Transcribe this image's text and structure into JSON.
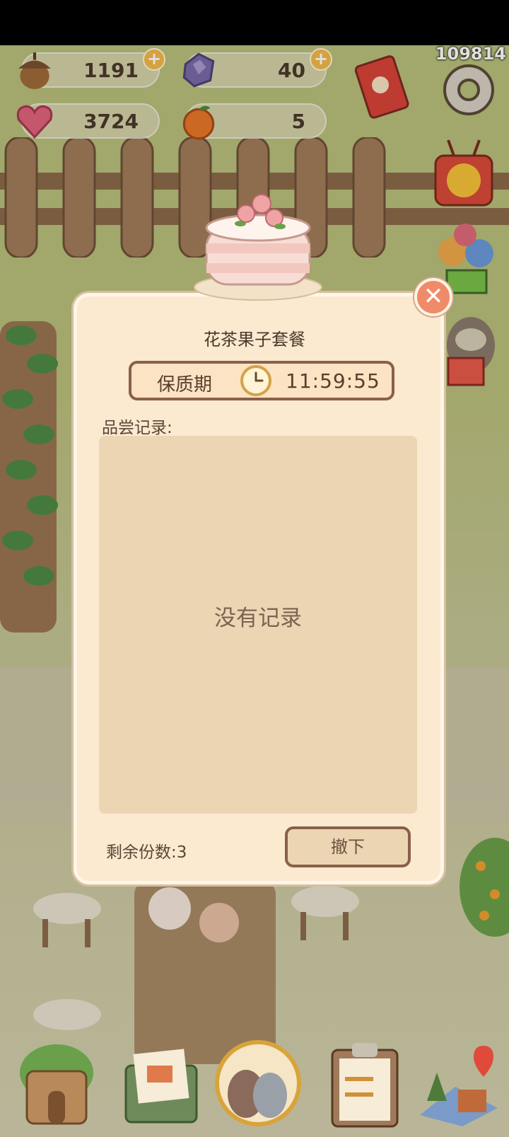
{
  "top_counter": "109814",
  "resources": {
    "acorn": {
      "value": "1191",
      "icon": "acorn-icon"
    },
    "gem": {
      "value": "40",
      "icon": "purple-gem-icon"
    },
    "heart": {
      "value": "3724",
      "icon": "pink-heart-icon"
    },
    "orange": {
      "value": "5",
      "icon": "orange-fruit-icon"
    },
    "plus": "+"
  },
  "dialog": {
    "title": "花茶果子套餐",
    "shelf_life_label": "保质期",
    "shelf_life_time": "11:59:55",
    "records_label": "品尝记录:",
    "empty_text": "没有记录",
    "remaining_label": "剩余份数:3",
    "withdraw_label": "撤下",
    "close_symbol": "✕"
  },
  "colors": {
    "dialog_bg": "#fbe9d0",
    "border_brown": "#8a6048",
    "close_red": "#f08b6a",
    "plus_orange": "#f3b94a"
  },
  "side_icons": [
    "red-envelope-icon",
    "gear-icon",
    "tv-chick-icon",
    "balloon-gift-icon",
    "sloth-gift-icon"
  ],
  "bottom_nav": [
    "home-stump-icon",
    "letter-envelope-icon",
    "birds-circle-icon",
    "clipboard-list-icon",
    "map-pin-icon"
  ]
}
